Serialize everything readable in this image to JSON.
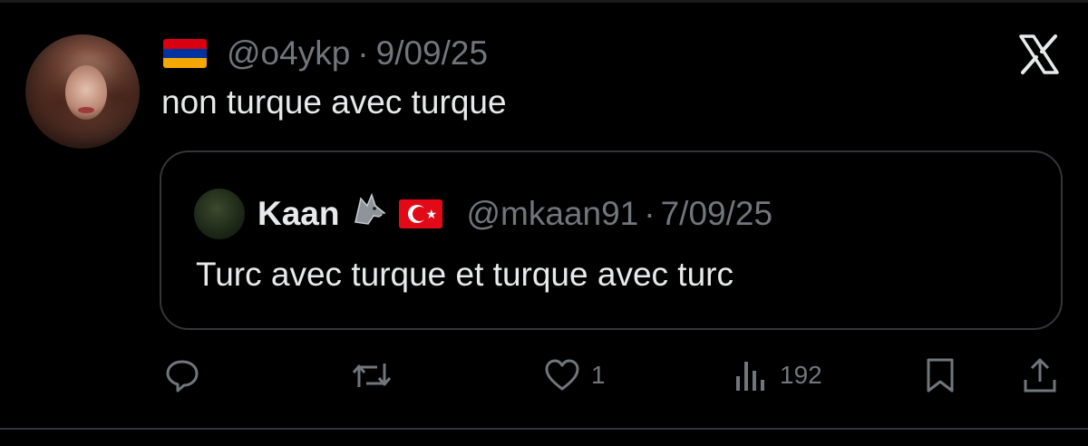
{
  "post": {
    "handle": "@o4ykp",
    "separator": "·",
    "date": "9/09/25",
    "text": "non turque avec turque",
    "flag_icon": "armenia-flag-icon"
  },
  "quoted_post": {
    "display_name": "Kaan",
    "emoji_icons": [
      "wolf-icon",
      "turkey-flag-icon"
    ],
    "handle": "@mkaan91",
    "separator": "·",
    "date": "7/09/25",
    "text": "Turc avec turque et turque avec turc"
  },
  "actions": {
    "reply_icon": "reply-icon",
    "repost_icon": "repost-icon",
    "like_icon": "heart-icon",
    "like_count": "1",
    "views_icon": "views-chart-icon",
    "views_count": "192",
    "bookmark_icon": "bookmark-icon",
    "share_icon": "share-icon"
  },
  "brand": {
    "logo_icon": "x-logo-icon"
  },
  "colors": {
    "background": "#000000",
    "primary_text": "#e7e9ea",
    "secondary_text": "#71767b",
    "border": "#333639"
  }
}
